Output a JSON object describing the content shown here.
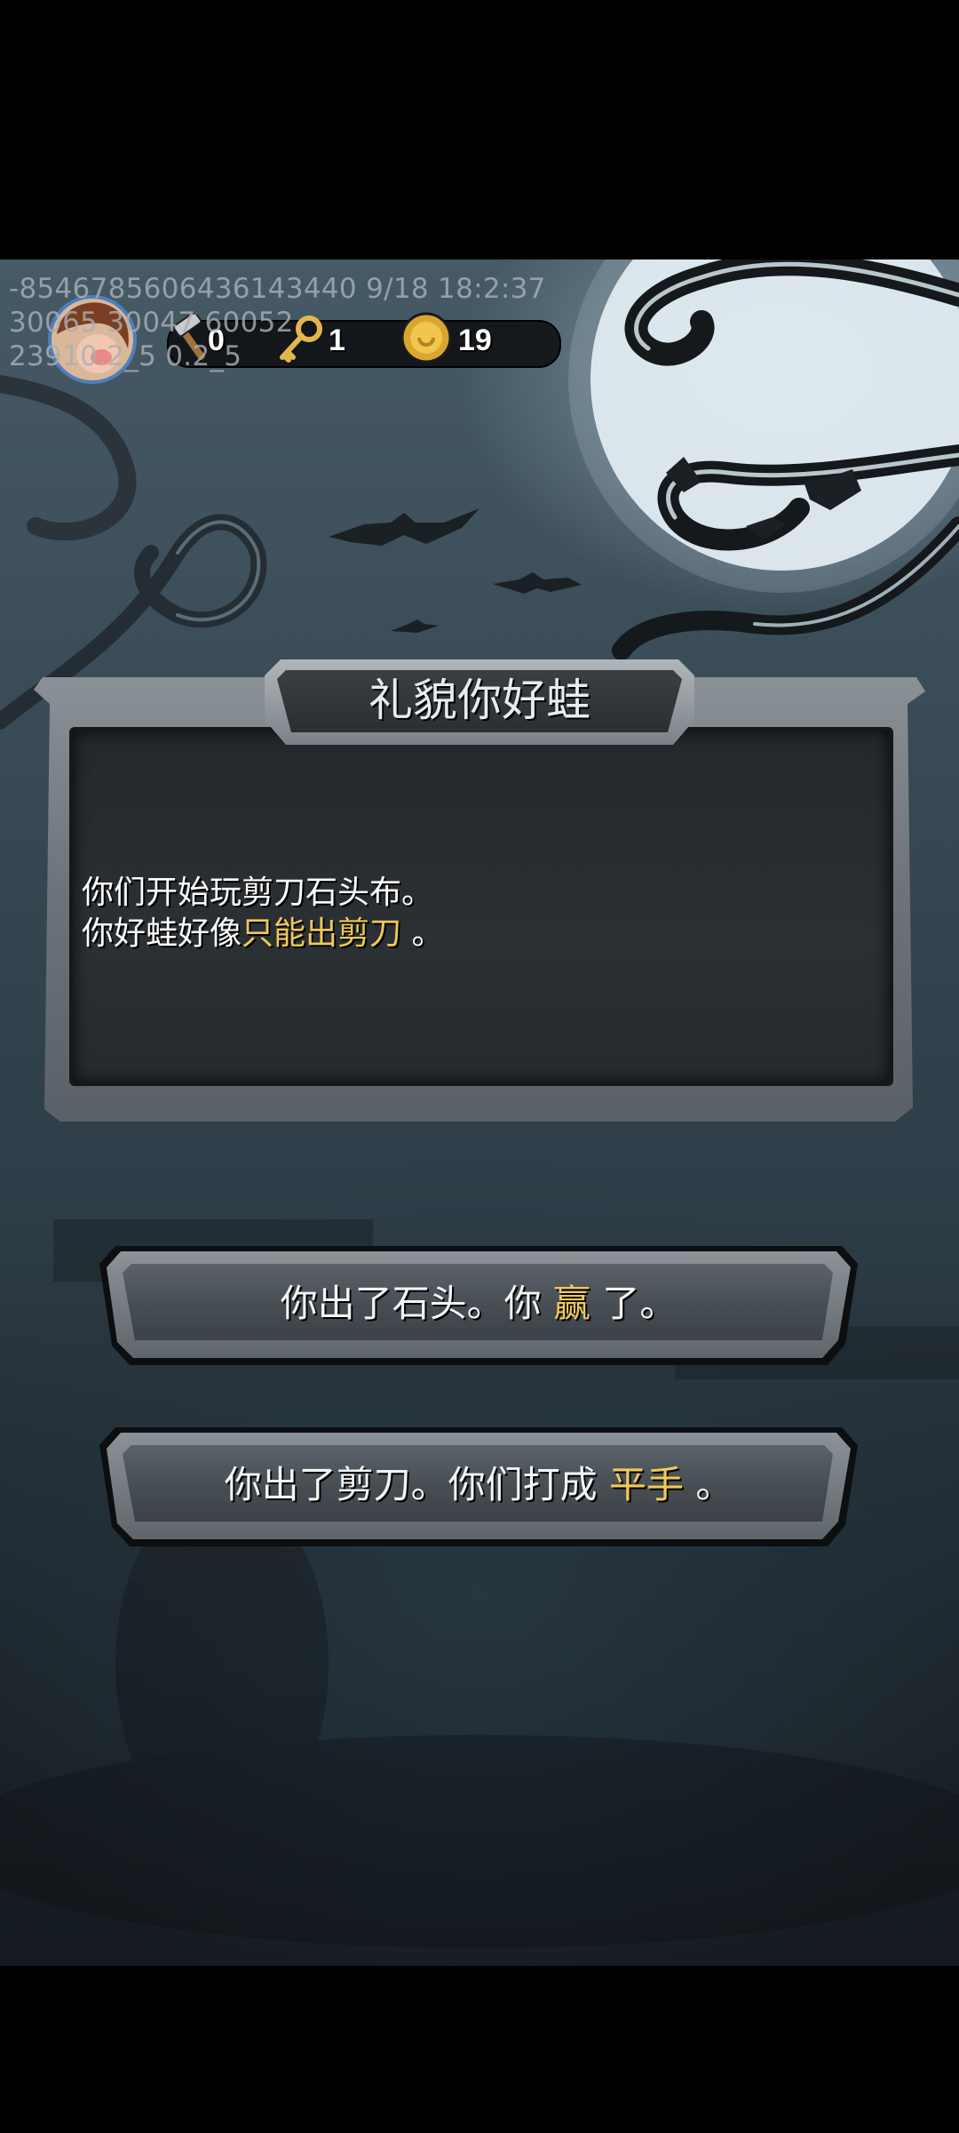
{
  "debug": {
    "line1": "-8546785606436143440 9/18 18:2:37",
    "line2": "30065 30047 60052",
    "line3": "23910.2_5 0.2_5"
  },
  "hud": {
    "tool_count": "0",
    "key_count": "1",
    "coin_count": "19"
  },
  "dialog": {
    "title": "礼貌你好蛙",
    "line1": "你们开始玩剪刀石头布。",
    "line2_prefix": "你好蛙好像",
    "line2_highlight": "只能出剪刀",
    "line2_suffix": " 。"
  },
  "choices": [
    {
      "prefix": "你出了石头。你 ",
      "highlight": "赢",
      "suffix": " 了。"
    },
    {
      "prefix": "你出了剪刀。你们打成 ",
      "highlight": "平手",
      "suffix": " 。"
    }
  ],
  "colors": {
    "highlight": "#f0c95a",
    "avatar_ring": "#4f7fbd",
    "coin": "#e0b43a"
  },
  "icons": [
    "avatar",
    "hammer-icon",
    "key-icon",
    "coin-icon"
  ]
}
